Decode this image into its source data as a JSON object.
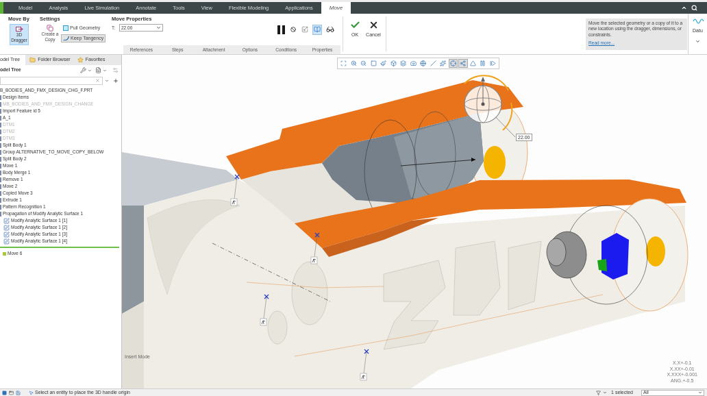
{
  "title_bar": {
    "tabs": [
      {
        "label": "Model",
        "selected": false
      },
      {
        "label": "Analysis",
        "selected": false
      },
      {
        "label": "Live Simulation",
        "selected": false
      },
      {
        "label": "Annotate",
        "selected": false
      },
      {
        "label": "Tools",
        "selected": false
      },
      {
        "label": "View",
        "selected": false
      },
      {
        "label": "Flexible Modeling",
        "selected": false
      },
      {
        "label": "Applications",
        "selected": false
      },
      {
        "label": "Move",
        "selected": true
      }
    ]
  },
  "ribbon": {
    "move_by": {
      "title": "Move By",
      "dragger": {
        "label": "3D Dragger",
        "selected": true
      }
    },
    "settings": {
      "title": "Settings",
      "create_copy": "Create a Copy",
      "pull_geometry": {
        "label": "Pull Geometry",
        "on": false
      },
      "keep_tangency": {
        "label": "Keep Tangency",
        "on": true
      }
    },
    "move_properties": {
      "title": "Move Properties",
      "field_label": "T:",
      "value": "22.00"
    },
    "sub_tabs": [
      "References",
      "Steps",
      "Attachment",
      "Options",
      "Conditions",
      "Properties"
    ],
    "tool_buttons": [
      {
        "pressed": false
      },
      {
        "pressed": false
      },
      {
        "pressed": false
      },
      {
        "pressed": true
      },
      {
        "pressed": false
      }
    ],
    "ok": "OK",
    "cancel": "Cancel",
    "help": {
      "text": "Move the selected geometry or a copy of it to a new location using the dragger, dimensions, or constraints.",
      "link": "Read more..."
    },
    "datum": "Datu"
  },
  "model_tree": {
    "tabs": [
      {
        "label": "odel Tree",
        "selected": true
      },
      {
        "label": "Folder Browser",
        "selected": false
      },
      {
        "label": "Favorites",
        "selected": false
      }
    ],
    "header": "odel Tree",
    "root": {
      "label": "B_BODIES_AND_FMX_DESIGN_CHG_F.PRT",
      "children": [
        {
          "label": "Design Items",
          "dimmed": false
        },
        {
          "label": "MB_BODIES_AND_FMX_DESIGN_CHANGE",
          "dimmed": true
        },
        {
          "label": "Import Feature id 5",
          "dimmed": false
        },
        {
          "label": "A_1",
          "dimmed": false
        },
        {
          "label": "DTM1",
          "dimmed": true
        },
        {
          "label": "DTM2",
          "dimmed": true
        },
        {
          "label": "DTM3",
          "dimmed": true
        },
        {
          "label": "Split Body 1",
          "dimmed": false
        },
        {
          "label": "Group ALTERNATIVE_TO_MOVE_COPY_BELOW",
          "dimmed": false
        },
        {
          "label": "Split Body 2",
          "dimmed": false
        },
        {
          "label": "Move 1",
          "dimmed": false
        },
        {
          "label": "Body Merge 1",
          "dimmed": false
        },
        {
          "label": "Remove 1",
          "dimmed": false
        },
        {
          "label": "Move 2",
          "dimmed": false
        },
        {
          "label": "Copied Move 3",
          "dimmed": false
        },
        {
          "label": "Extrude 1",
          "dimmed": false
        },
        {
          "label": "Pattern Recognition 1",
          "dimmed": false
        },
        {
          "label": "Propagation of Modify Analytic Surface 1",
          "dimmed": false,
          "children": [
            {
              "label": "Modify Analytic Surface 1 [1]",
              "dimmed": false
            },
            {
              "label": "Modify Analytic Surface 1 [2]",
              "dimmed": false
            },
            {
              "label": "Modify Analytic Surface 1 [3]",
              "dimmed": false
            },
            {
              "label": "Modify Analytic Surface 1 [4]",
              "dimmed": false
            }
          ]
        }
      ]
    },
    "after_insert": [
      {
        "label": "Move 6",
        "dimmed": false
      }
    ]
  },
  "viewport": {
    "view_toolbar": [
      {
        "pressed": false
      },
      {
        "pressed": false
      },
      {
        "pressed": false
      },
      {
        "pressed": false
      },
      {
        "pressed": false
      },
      {
        "pressed": false
      },
      {
        "pressed": false
      },
      {
        "pressed": false
      },
      {
        "pressed": false
      },
      {
        "pressed": false
      },
      {
        "pressed": false
      },
      {
        "pressed": true
      },
      {
        "pressed": true
      },
      {
        "pressed": false
      },
      {
        "pressed": false
      },
      {
        "pressed": false
      }
    ],
    "dimension": "22.00",
    "mode": "Insert Mode",
    "tolerances": [
      "X.X+-0.1",
      "X.XX+-0.01",
      "X.XXX+-0.001",
      "ANG.+-0.5"
    ]
  },
  "status_bar": {
    "message": "Select an entity to place the 3D handle origin",
    "selection": "1 selected",
    "filter": "All"
  }
}
